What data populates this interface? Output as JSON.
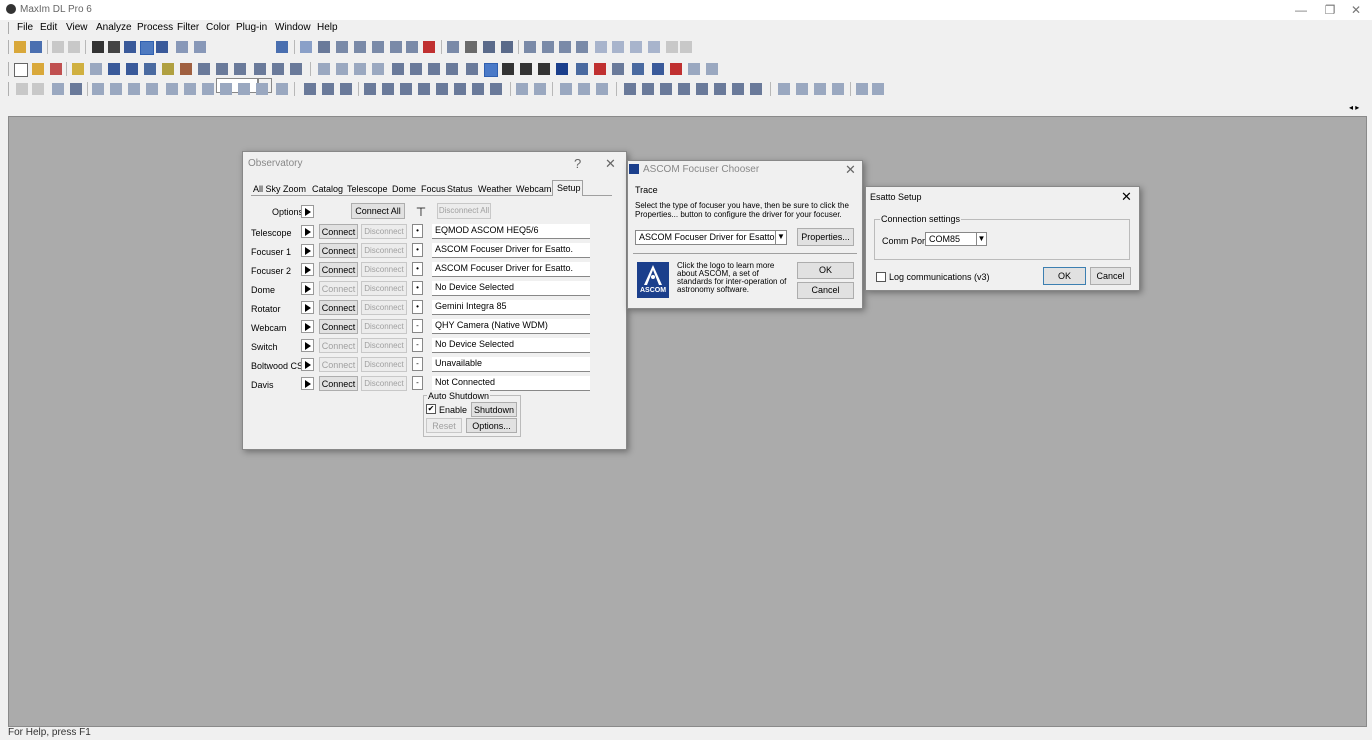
{
  "app": {
    "title": "MaxIm DL Pro 6"
  },
  "window_controls": {
    "minimize": "—",
    "restore": "❐",
    "close": "✕"
  },
  "menu": [
    "File",
    "Edit",
    "View",
    "Analyze",
    "Process",
    "Filter",
    "Color",
    "Plug-in",
    "Window",
    "Help"
  ],
  "statusbar": {
    "text": "For Help, press F1"
  },
  "observatory": {
    "title": "Observatory",
    "help": "?",
    "close": "✕",
    "tabs": [
      "All Sky",
      "Zoom",
      "Catalog",
      "Telescope",
      "Dome",
      "Focus",
      "Status",
      "Weather",
      "Webcam",
      "Setup"
    ],
    "options_label": "Options",
    "connect_all": "Connect All",
    "disconnect_all": "Disconnect All",
    "connect": "Connect",
    "disconnect": "Disconnect",
    "devices": [
      {
        "label": "Telescope",
        "name": "EQMOD ASCOM HEQ5/6",
        "connect_enabled": true,
        "dot": "•"
      },
      {
        "label": "Focuser 1",
        "name": "ASCOM Focuser Driver for Esatto.",
        "connect_enabled": true,
        "dot": "•"
      },
      {
        "label": "Focuser 2",
        "name": "ASCOM Focuser Driver for Esatto.",
        "connect_enabled": true,
        "dot": "•"
      },
      {
        "label": "Dome",
        "name": "No Device Selected",
        "connect_enabled": false,
        "dot": "•"
      },
      {
        "label": "Rotator",
        "name": "Gemini Integra 85",
        "connect_enabled": true,
        "dot": "•"
      },
      {
        "label": "Webcam",
        "name": "QHY Camera (Native WDM)",
        "connect_enabled": true,
        "dot": "-"
      },
      {
        "label": "Switch",
        "name": "No Device Selected",
        "connect_enabled": false,
        "dot": "-"
      },
      {
        "label": "Boltwood CS",
        "name": "Unavailable",
        "connect_enabled": false,
        "dot": "-"
      },
      {
        "label": "Davis",
        "name": "Not Connected",
        "connect_enabled": true,
        "dot": "-"
      }
    ],
    "auto_shutdown": {
      "title": "Auto Shutdown",
      "enable_label": "Enable",
      "enabled": true,
      "shutdown": "Shutdown",
      "reset": "Reset",
      "options": "Options..."
    }
  },
  "focuser_chooser": {
    "title": "ASCOM Focuser Chooser",
    "close": "✕",
    "menu": "Trace",
    "instructions": "Select the type of focuser you have, then be sure to click the Properties... button to configure the driver for your focuser.",
    "selected_driver": "ASCOM Focuser Driver for Esatto.",
    "properties": "Properties...",
    "logo_text": "ASCOM",
    "info": "Click the logo to learn more about ASCOM, a set of standards for inter-operation of astronomy software.",
    "ok": "OK",
    "cancel": "Cancel"
  },
  "esatto": {
    "title": "Esatto Setup",
    "close": "✕",
    "group": "Connection settings",
    "comm_port_label": "Comm Port",
    "comm_port_value": "COM85",
    "log_label": "Log communications (v3)",
    "log_checked": false,
    "ok": "OK",
    "cancel": "Cancel"
  },
  "colors": {
    "workspace": "#ababab",
    "ascom_blue": "#1b3f8c"
  }
}
